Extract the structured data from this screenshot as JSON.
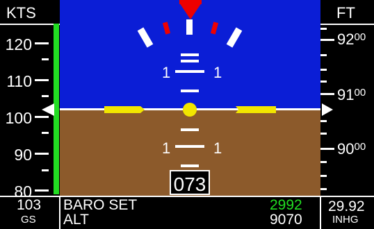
{
  "airspeed": {
    "header": "KTS",
    "scale_labels": [
      "120",
      "110",
      "100",
      "90",
      "80"
    ],
    "readout": "103",
    "readout_unit": "GS",
    "speed_band_color": "#22dd22"
  },
  "altitude": {
    "header": "FT",
    "scale_labels": [
      {
        "major": "92",
        "minor": "00"
      },
      {
        "major": "91",
        "minor": "00"
      },
      {
        "major": "90",
        "minor": "00"
      }
    ]
  },
  "attitude": {
    "pitch_labels_upper": {
      "left": "1",
      "right": "1"
    },
    "pitch_labels_lower": {
      "left": "1",
      "right": "1"
    },
    "heading": "073",
    "colors": {
      "sky": "#0b1ed6",
      "ground": "#8c5a2b",
      "aircraft_symbol": "#f2e600",
      "bank_pointer": "#e00000"
    }
  },
  "status_bar": {
    "baro_set_label": "BARO SET",
    "baro_set_value": "2992",
    "alt_label": "ALT",
    "alt_value": "9070",
    "baro_readout": "29.92",
    "baro_unit": "INHG",
    "baro_set_value_color": "#22dd22"
  }
}
